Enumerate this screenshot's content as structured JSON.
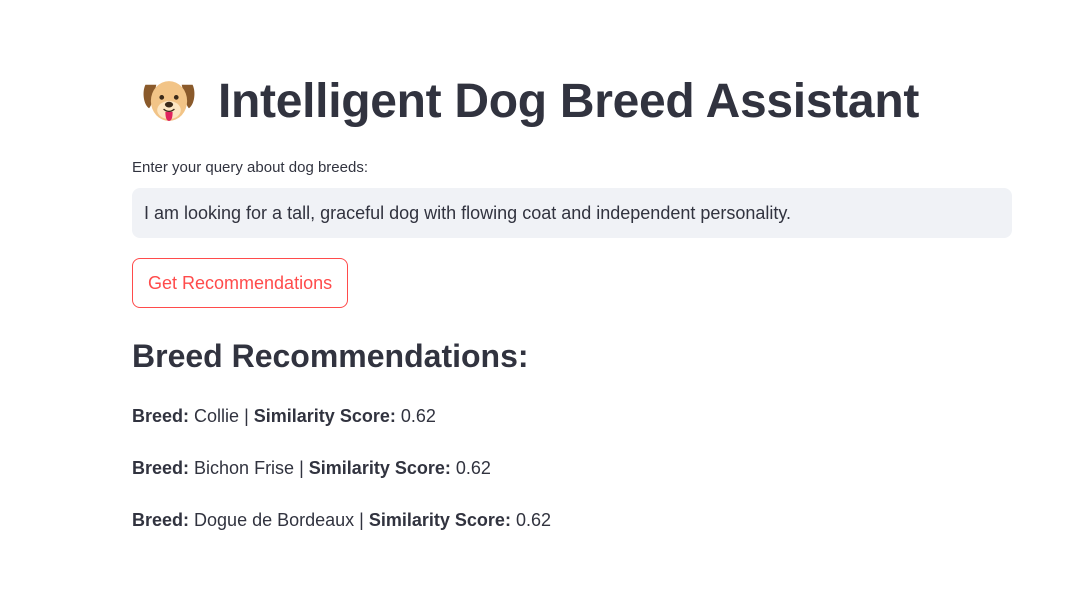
{
  "header": {
    "icon": "dog-face-icon",
    "title": "Intelligent Dog Breed Assistant"
  },
  "query": {
    "label": "Enter your query about dog breeds:",
    "value": "I am looking for a tall, graceful dog with flowing coat and independent personality."
  },
  "button": {
    "label": "Get Recommendations"
  },
  "results": {
    "heading": "Breed Recommendations:",
    "breed_label": "Breed:",
    "separator": "|",
    "score_label": "Similarity Score:",
    "items": [
      {
        "breed": "Collie",
        "score": "0.62"
      },
      {
        "breed": "Bichon Frise",
        "score": "0.62"
      },
      {
        "breed": "Dogue de Bordeaux",
        "score": "0.62"
      }
    ]
  },
  "colors": {
    "text": "#31333f",
    "accent": "#ff4b4b",
    "input_bg": "#f0f2f6"
  }
}
